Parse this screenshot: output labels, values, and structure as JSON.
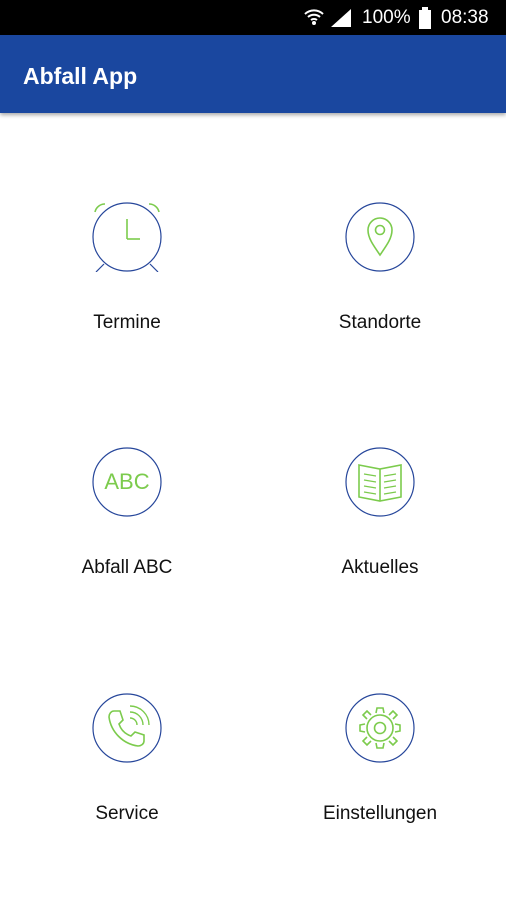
{
  "status_bar": {
    "battery_percent": "100%",
    "time": "08:38",
    "icons": [
      "wifi-icon",
      "signal-icon",
      "battery-icon"
    ]
  },
  "app_bar": {
    "title": "Abfall App"
  },
  "colors": {
    "app_bar": "#1a479f",
    "circle_outline": "#27479b",
    "icon_green": "#7ccb4d"
  },
  "menu": {
    "items": [
      {
        "label": "Termine",
        "icon": "alarm-clock-icon"
      },
      {
        "label": "Standorte",
        "icon": "location-pin-icon"
      },
      {
        "label": "Abfall ABC",
        "icon": "abc-icon",
        "icon_text": "ABC"
      },
      {
        "label": "Aktuelles",
        "icon": "open-book-icon"
      },
      {
        "label": "Service",
        "icon": "phone-icon"
      },
      {
        "label": "Einstellungen",
        "icon": "gear-icon"
      }
    ]
  }
}
